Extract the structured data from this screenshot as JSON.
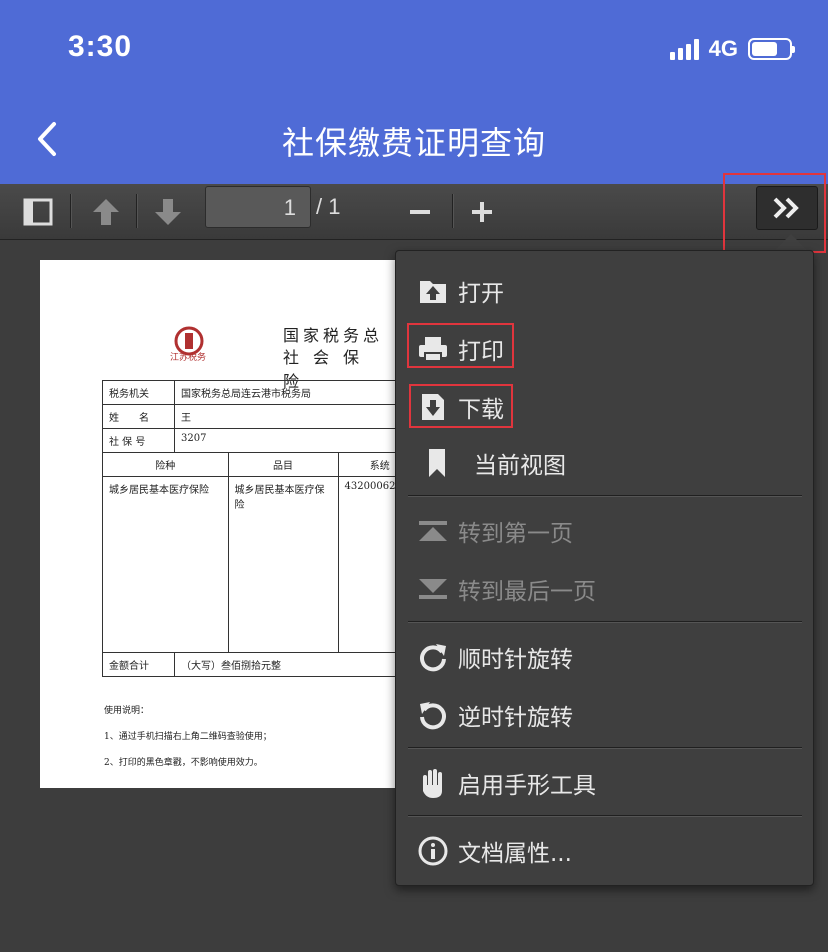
{
  "status_bar": {
    "time": "3:30",
    "network": "4G",
    "battery_level": 0.7
  },
  "header": {
    "title": "社保缴费证明查询"
  },
  "toolbar": {
    "page_current": "1",
    "page_total": "/ 1"
  },
  "document": {
    "title_line1": "国家税务总",
    "title_line2": "社会保险",
    "logo_text": "江苏税务",
    "rows": {
      "tax_office_label": "税务机关",
      "tax_office_value": "国家税务总局连云港市税务局",
      "name_label": "姓　　名",
      "name_value": "王",
      "ss_number_label": "社 保 号",
      "ss_number_value": "3207",
      "col_insurance": "险种",
      "col_item": "品目",
      "col_system": "系统",
      "insurance_value": "城乡居民基本医疗保险",
      "item_value": "城乡居民基本医疗保险",
      "system_value": "43200062",
      "total_label": "金额合计",
      "total_value": "（大写）叁佰捌拾元整"
    },
    "notes_title": "使用说明：",
    "note1": "1、通过手机扫描右上角二维码查验使用；",
    "note2": "2、打印的黑色章戳，不影响使用效力。"
  },
  "menu": {
    "open": "打开",
    "print": "打印",
    "download": "下载",
    "current_view": "当前视图",
    "first_page": "转到第一页",
    "last_page": "转到最后一页",
    "rotate_cw": "顺时针旋转",
    "rotate_ccw": "逆时针旋转",
    "hand_tool": "启用手形工具",
    "doc_properties": "文档属性..."
  },
  "colors": {
    "header_bg": "#4f6bd6",
    "highlight": "#e0353d",
    "menu_bg": "#3f3f3f"
  }
}
